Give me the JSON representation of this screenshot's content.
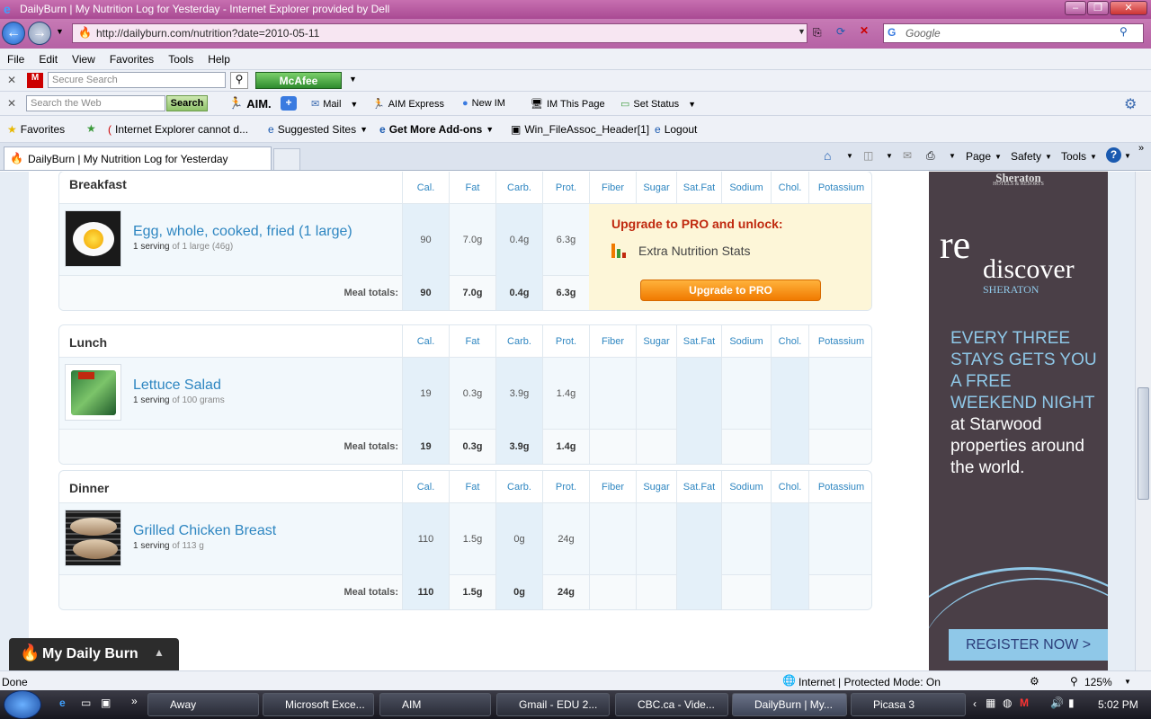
{
  "window": {
    "title": "DailyBurn | My Nutrition Log for Yesterday - Internet Explorer provided by Dell"
  },
  "address": {
    "url": "http://dailyburn.com/nutrition?date=2010-05-11",
    "search_placeholder": "Google"
  },
  "menu": [
    "File",
    "Edit",
    "View",
    "Favorites",
    "Tools",
    "Help"
  ],
  "mcafee": {
    "secure_search_placeholder": "Secure Search",
    "logo": "McAfee"
  },
  "aim_toolbar": {
    "search_placeholder": "Search the Web",
    "search_button": "Search",
    "aim_logo": "AIM.",
    "mail": "Mail",
    "aim_express": "AIM Express",
    "new_im": "New IM",
    "im_this_page": "IM This Page",
    "set_status": "Set Status"
  },
  "favorites_bar": {
    "favorites": "Favorites",
    "items": [
      "Internet Explorer cannot d...",
      "Suggested Sites",
      "Get More Add-ons",
      "Win_FileAssoc_Header[1]",
      "Logout"
    ]
  },
  "tab": {
    "title": "DailyBurn | My Nutrition Log for Yesterday"
  },
  "command_bar": {
    "page": "Page",
    "safety": "Safety",
    "tools": "Tools"
  },
  "columns": [
    "Cal.",
    "Fat",
    "Carb.",
    "Prot.",
    "Fiber",
    "Sugar",
    "Sat.Fat",
    "Sodium",
    "Chol.",
    "Potassium"
  ],
  "meals": [
    {
      "name": "Breakfast",
      "food": "Egg, whole, cooked, fried (1 large)",
      "serving_qty": "1 serving",
      "serving_unit": "of 1 large (46g)",
      "values": [
        "90",
        "7.0g",
        "0.4g",
        "6.3g"
      ],
      "totals_label": "Meal totals:",
      "totals": [
        "90",
        "7.0g",
        "0.4g",
        "6.3g"
      ]
    },
    {
      "name": "Lunch",
      "food": "Lettuce Salad",
      "serving_qty": "1 serving",
      "serving_unit": "of 100 grams",
      "values": [
        "19",
        "0.3g",
        "3.9g",
        "1.4g"
      ],
      "totals_label": "Meal totals:",
      "totals": [
        "19",
        "0.3g",
        "3.9g",
        "1.4g"
      ]
    },
    {
      "name": "Dinner",
      "food": "Grilled Chicken Breast",
      "serving_qty": "1 serving",
      "serving_unit": "of 113 g",
      "values": [
        "110",
        "1.5g",
        "0g",
        "24g"
      ],
      "totals_label": "Meal totals:",
      "totals": [
        "110",
        "1.5g",
        "0g",
        "24g"
      ]
    }
  ],
  "upsell": {
    "heading": "Upgrade to PRO and unlock:",
    "feature": "Extra Nutrition Stats",
    "button": "Upgrade to PRO"
  },
  "ad": {
    "brand": "Sheraton",
    "brand_sub": "HOTELS & RESORTS",
    "headline_re": "re",
    "headline_discover": "discover",
    "headline_brand": "SHERATON",
    "copy_highlight": "EVERY THREE STAYS GETS YOU A FREE WEEKEND NIGHT",
    "copy_rest": " at Starwood properties around the world.",
    "cta": "REGISTER NOW  >"
  },
  "widget": {
    "label": "My Daily Burn"
  },
  "status": {
    "left": "Done",
    "zone": "Internet | Protected Mode: On",
    "zoom": "125%"
  },
  "taskbar": {
    "tasks": [
      "Away",
      "Microsoft Exce...",
      "AIM",
      "Gmail - EDU 2...",
      "CBC.ca - Vide...",
      "DailyBurn | My...",
      "Picasa 3"
    ],
    "clock": "5:02 PM"
  },
  "colors": {
    "link": "#2e86c1",
    "upsell_heading": "#c0290f",
    "ad_bg": "#4a3f47",
    "ad_accent": "#8fc8e8",
    "titlebar": "#b45aa0"
  }
}
